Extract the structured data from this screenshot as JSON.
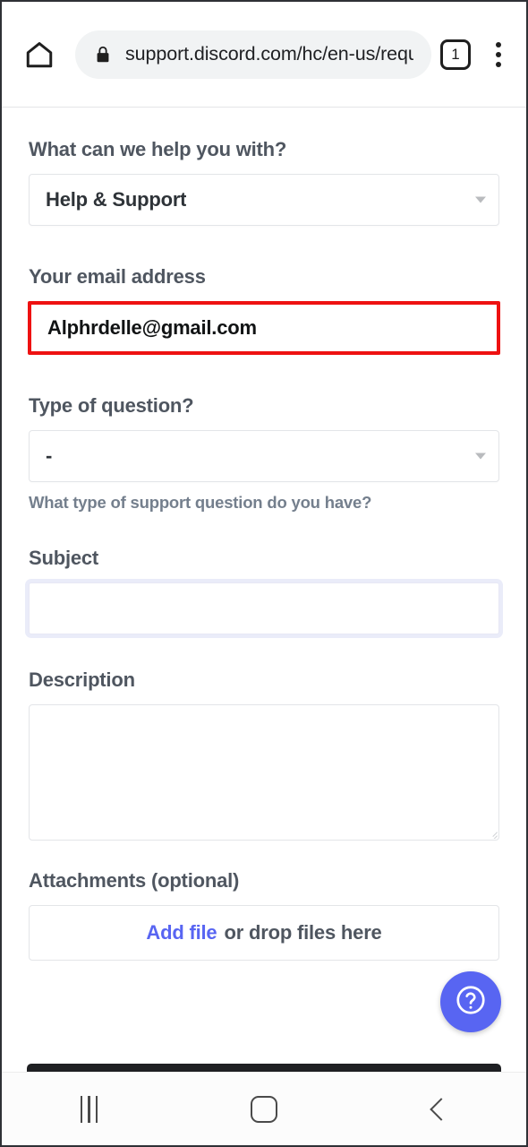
{
  "browser": {
    "home_icon": "home-icon",
    "lock_icon": "lock-icon",
    "url": "support.discord.com/hc/en-us/reques",
    "tab_count": "1",
    "overflow_icon": "three-dots-vertical-icon"
  },
  "form": {
    "help_topic": {
      "label": "What can we help you with?",
      "value": "Help & Support"
    },
    "email": {
      "label": "Your email address",
      "value": "Alphrdelle@gmail.com",
      "placeholder": "",
      "highlight_color": "#ee1111"
    },
    "question_type": {
      "label": "Type of question?",
      "value": "-",
      "hint": "What type of support question do you have?"
    },
    "subject": {
      "label": "Subject",
      "value": "",
      "placeholder": ""
    },
    "description": {
      "label": "Description",
      "value": "",
      "placeholder": ""
    },
    "attachments": {
      "label": "Attachments (optional)",
      "add_file_label": "Add file",
      "drop_hint": "or drop files here"
    }
  },
  "help_fab": {
    "icon": "question-mark-circle-icon",
    "color": "#5865f2"
  },
  "android_nav": {
    "recents_icon": "recents-icon",
    "home_icon": "home-square-icon",
    "back_icon": "back-chevron-icon"
  }
}
